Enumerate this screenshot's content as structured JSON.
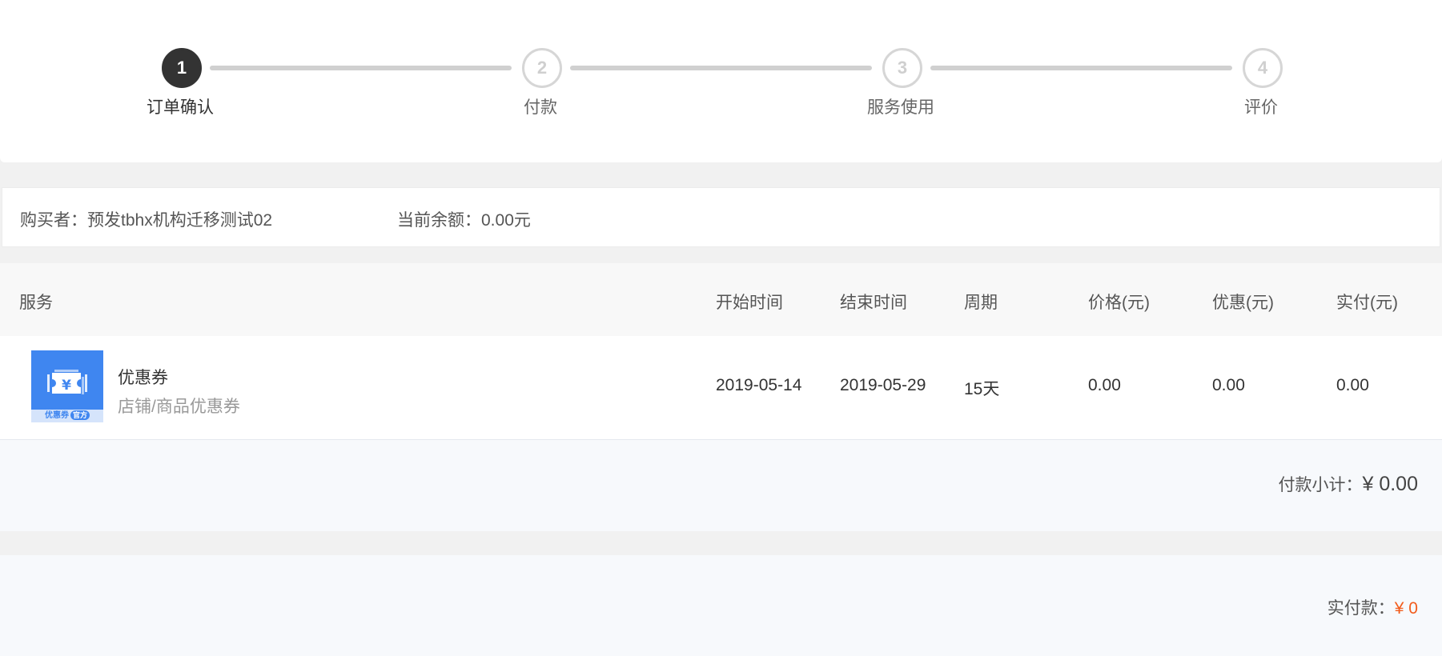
{
  "steps": [
    {
      "number": "1",
      "label": "订单确认",
      "active": true
    },
    {
      "number": "2",
      "label": "付款",
      "active": false
    },
    {
      "number": "3",
      "label": "服务使用",
      "active": false
    },
    {
      "number": "4",
      "label": "评价",
      "active": false
    }
  ],
  "buyer": {
    "buyer_text": "购买者：预发tbhx机构迁移测试02",
    "balance_text": "当前余额：0.00元"
  },
  "table": {
    "headers": {
      "service": "服务",
      "start": "开始时间",
      "end": "结束时间",
      "period": "周期",
      "price": "价格(元)",
      "discount": "优惠(元)",
      "paid": "实付(元)"
    },
    "row": {
      "icon": "coupon-icon",
      "icon_glyph": "¥",
      "icon_caption": "优惠券",
      "icon_tag": "官方",
      "name": "优惠券",
      "desc": "店铺/商品优惠券",
      "start": "2019-05-14",
      "end": "2019-05-29",
      "period": "15天",
      "price": "0.00",
      "discount": "0.00",
      "paid": "0.00"
    }
  },
  "subtotal": {
    "label": "付款小计：",
    "amount": "¥ 0.00"
  },
  "total": {
    "label": "实付款：",
    "amount": "¥ 0"
  },
  "colors": {
    "accent": "#f25c1c",
    "active_step": "#333333",
    "coupon_blue": "#3f86f0"
  }
}
